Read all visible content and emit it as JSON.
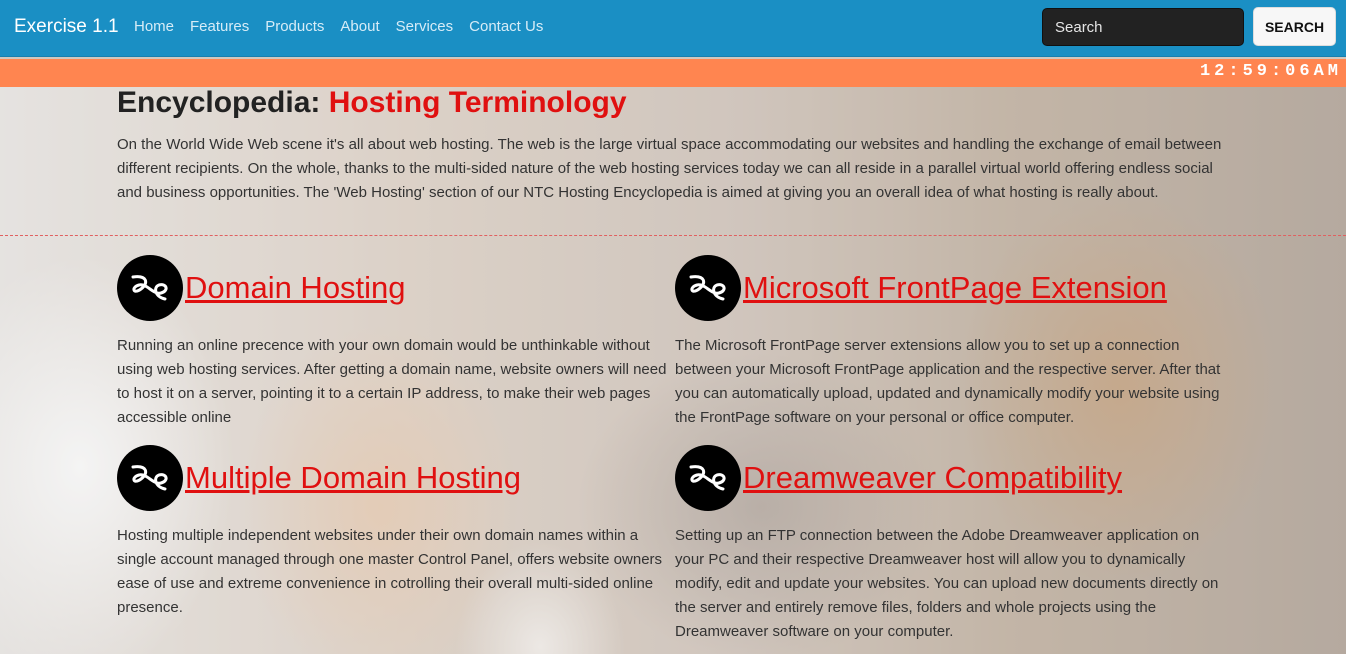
{
  "navbar": {
    "brand": "Exercise 1.1",
    "links": [
      "Home",
      "Features",
      "Products",
      "About",
      "Services",
      "Contact Us"
    ],
    "search_placeholder": "Search",
    "search_button": "SEARCH"
  },
  "clock": "12:59:06AM",
  "page": {
    "title_prefix": "Encyclopedia:",
    "title_highlight": "Hosting Terminology",
    "intro": "On the World Wide Web scene it's all about web hosting. The web is the large virtual space accommodating our websites and handling the exchange of email between different recipients. On the whole, thanks to the multi-sided nature of the web hosting services today we can all reside in a parallel virtual world offering endless social and business opportunities. The 'Web Hosting' section of our NTC Hosting Encyclopedia is aimed at giving you an overall idea of what hosting is really about."
  },
  "features": [
    {
      "title": "Domain Hosting",
      "text": "Running an online precence with your own domain would be unthinkable without using web hosting services. After getting a domain name, website owners will need to host it on a server, pointing it to a certain IP address, to make their web pages accessible online"
    },
    {
      "title": "Microsoft FrontPage Extension",
      "text": "The Microsoft FrontPage server extensions allow you to set up a connection between your Microsoft FrontPage application and the respective server. After that you can automatically upload, updated and dynamically modify your website using the FrontPage software on your personal or office computer."
    },
    {
      "title": "Multiple Domain Hosting",
      "text": "Hosting multiple independent websites under their own domain names within a single account managed through one master Control Panel, offers website owners ease of use and extreme convenience in cotrolling their overall multi-sided online presence."
    },
    {
      "title": "Dreamweaver Compatibility",
      "text": "Setting up an FTP connection between the Adobe Dreamweaver application on your PC and their respective Dreamweaver host will allow you to dynamically modify, edit and update your websites. You can upload new documents directly on the server and entirely remove files, folders and whole projects using the Dreamweaver software on your computer."
    }
  ],
  "colors": {
    "navbar": "#1a8fc4",
    "strip": "#ff8550",
    "accent": "#e01010"
  }
}
